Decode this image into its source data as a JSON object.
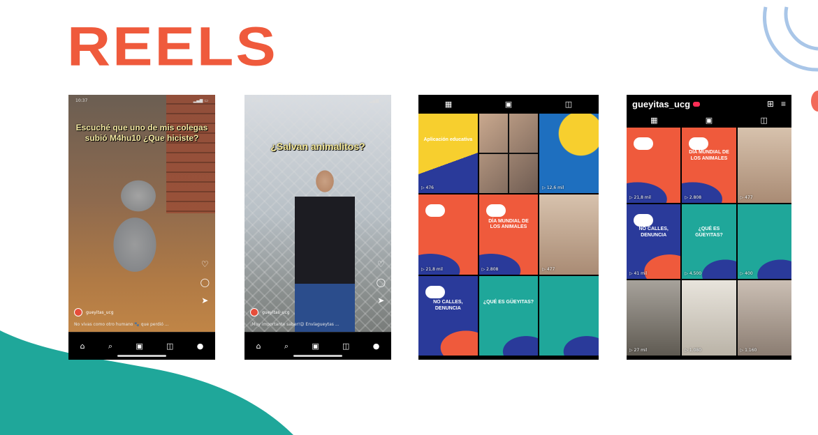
{
  "slide": {
    "title": "REELS",
    "accent_color": "#ef5a3c",
    "teal_color": "#1fa79a",
    "arc_color": "#a9c6e8"
  },
  "phones": {
    "reel1": {
      "caption": "Escuché que uno de mis colegas subió M4hu10 ¿Que hiciste?",
      "author": "gueyitas_ucg",
      "description": "No vivas como otro humano 🐾 que perdió ..."
    },
    "reel2": {
      "caption": "¿Salvan animalitos?",
      "author": "gueyitas_ucg",
      "description": "¡Muy importante saber!😉 Envíagueytas ..."
    },
    "grid1": {
      "tiles": [
        {
          "style": "t-yellow",
          "label": "Aplicación educativa",
          "views": "▷ 476"
        },
        {
          "style": "t-collage",
          "label": "",
          "views": ""
        },
        {
          "style": "t-phone-promo",
          "label": "",
          "views": "▷ 12,6 mil"
        },
        {
          "style": "t-red",
          "label": "",
          "views": ""
        },
        {
          "style": "t-red",
          "label": "DÍA MUNDIAL DE LOS ANIMALES",
          "views": "▷ 2.808"
        },
        {
          "style": "t-photo-a",
          "label": "",
          "views": "▷ 477"
        },
        {
          "style": "t-blue",
          "label": "NO CALLES, DENUNCIA",
          "views": ""
        },
        {
          "style": "t-teal",
          "label": "¿QUÉ ES GÜEYITAS?",
          "views": ""
        },
        {
          "style": "t-teal",
          "label": "",
          "views": ""
        }
      ],
      "views_left_mid": "▷ 21,8 mil"
    },
    "grid2": {
      "username": "gueyitas_ucg",
      "tiles": [
        {
          "style": "t-red",
          "label": "",
          "views": "▷ 21,8 mil"
        },
        {
          "style": "t-red",
          "label": "DÍA MUNDIAL DE LOS ANIMALES",
          "views": "▷ 2.808"
        },
        {
          "style": "t-photo-a",
          "label": "",
          "views": "▷ 477"
        },
        {
          "style": "t-blue",
          "label": "NO CALLES, DENUNCIA",
          "views": "▷ 41 mil"
        },
        {
          "style": "t-teal",
          "label": "¿QUÉ ES GÜEYITAS?",
          "views": "▷ 4.500"
        },
        {
          "style": "t-teal",
          "label": "",
          "views": "▷ 400"
        },
        {
          "style": "t-photo-c",
          "label": "",
          "views": "▷ 27 mil"
        },
        {
          "style": "t-photo-d",
          "label": "",
          "views": "▷ 1.080"
        },
        {
          "style": "t-photo-b",
          "label": "",
          "views": "▷ 1.160"
        }
      ]
    }
  }
}
